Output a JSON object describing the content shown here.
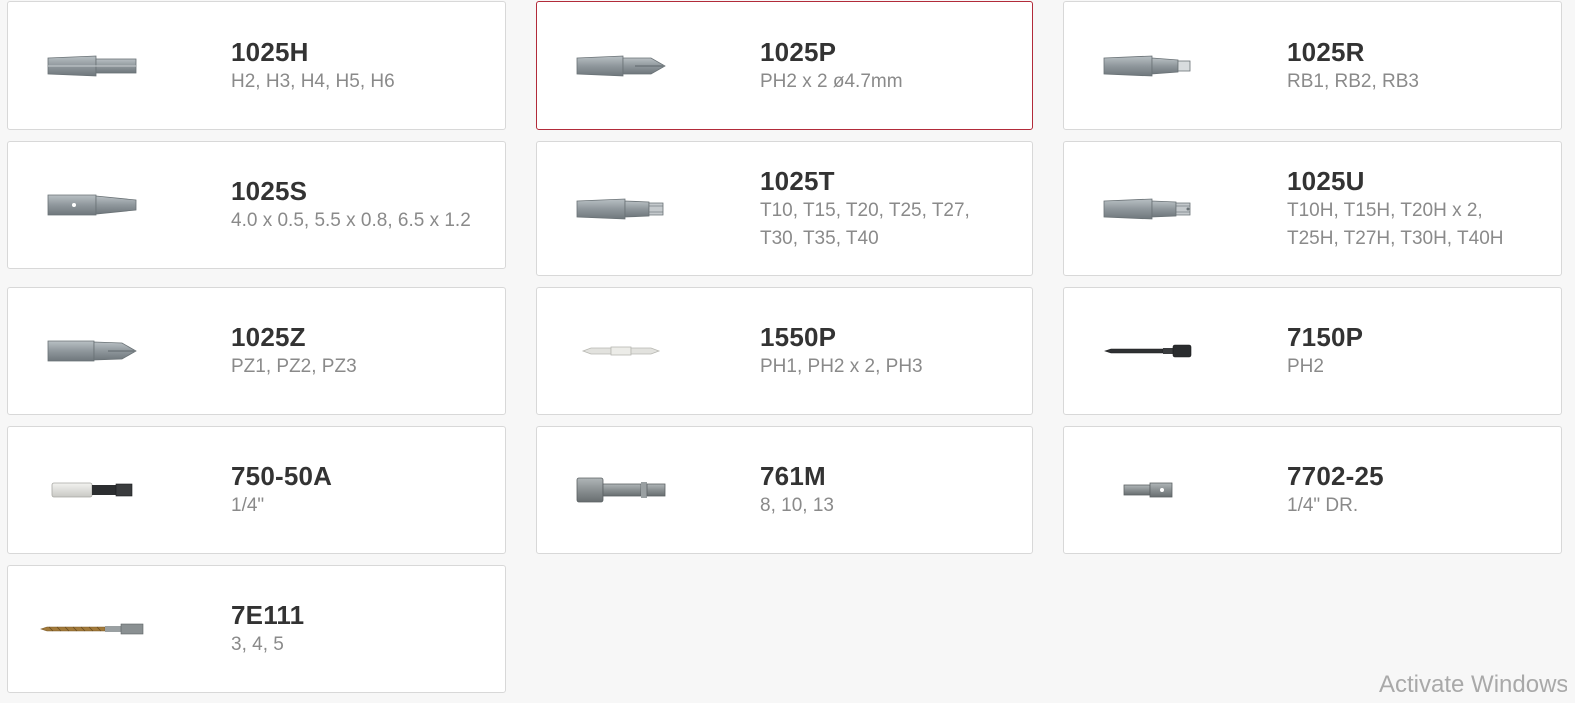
{
  "products": [
    {
      "code": "1025H",
      "desc": "H2, H3, H4, H5, H6",
      "icon": "hex-bit-icon"
    },
    {
      "code": "1025P",
      "desc": "PH2 x 2 ø4.7mm",
      "icon": "phillips-bit-icon",
      "selected": true
    },
    {
      "code": "1025R",
      "desc": "RB1, RB2, RB3",
      "icon": "square-bit-icon"
    },
    {
      "code": "1025S",
      "desc": "4.0 x 0.5, 5.5 x 0.8, 6.5 x 1.2",
      "icon": "slotted-bit-icon"
    },
    {
      "code": "1025T",
      "desc": "T10, T15, T20, T25, T27, T30, T35, T40",
      "icon": "torx-bit-icon"
    },
    {
      "code": "1025U",
      "desc": "T10H, T15H, T20H x 2, T25H, T27H, T30H, T40H",
      "icon": "security-torx-bit-icon"
    },
    {
      "code": "1025Z",
      "desc": "PZ1, PZ2, PZ3",
      "icon": "pozidriv-bit-icon"
    },
    {
      "code": "1550P",
      "desc": "PH1, PH2 x 2, PH3",
      "icon": "double-ended-bit-icon"
    },
    {
      "code": "7150P",
      "desc": "PH2",
      "icon": "power-bit-icon"
    },
    {
      "code": "750-50A",
      "desc": "1/4\"",
      "icon": "bit-holder-icon"
    },
    {
      "code": "761M",
      "desc": "8, 10, 13",
      "icon": "nut-setter-icon"
    },
    {
      "code": "7702-25",
      "desc": "1/4\" DR.",
      "icon": "socket-adapter-icon"
    },
    {
      "code": "7E111",
      "desc": "3, 4, 5",
      "icon": "drill-bit-icon"
    }
  ],
  "watermark": "Activate Windows",
  "colors": {
    "selected_border": "#b22b3a",
    "title": "#333333",
    "desc": "#8a8a8a"
  }
}
